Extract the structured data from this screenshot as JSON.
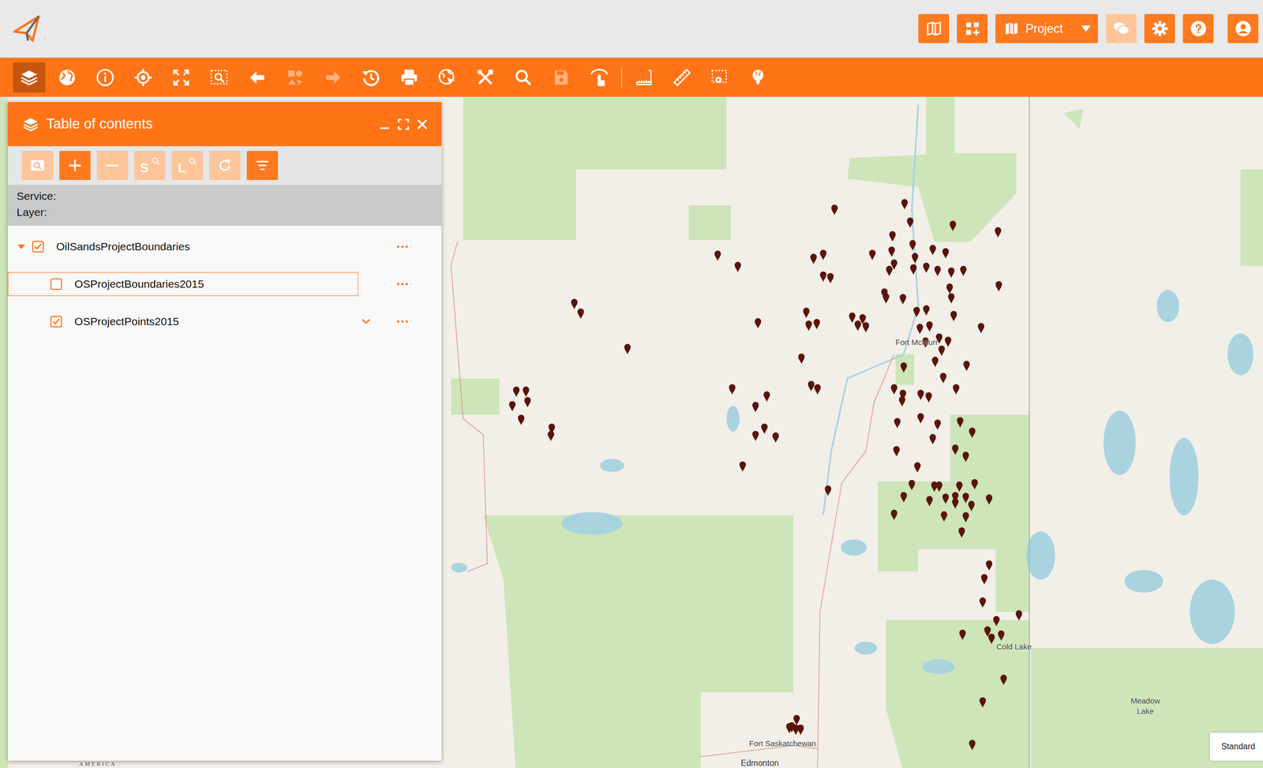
{
  "header": {
    "buttons": [
      {
        "kind": "icon",
        "disabled": false
      },
      {
        "kind": "icon",
        "disabled": false
      },
      {
        "kind": "dropdown",
        "label": "Project",
        "disabled": false
      },
      {
        "kind": "icon",
        "disabled": true
      },
      {
        "kind": "icon",
        "disabled": false
      },
      {
        "kind": "icon",
        "disabled": false
      },
      {
        "kind": "icon",
        "disabled": false
      }
    ]
  },
  "toolbar": {
    "items": [
      {
        "selected": true,
        "disabled": false
      },
      {
        "selected": false,
        "disabled": false
      },
      {
        "selected": false,
        "disabled": false
      },
      {
        "selected": false,
        "disabled": false
      },
      {
        "selected": false,
        "disabled": false
      },
      {
        "selected": false,
        "disabled": false
      },
      {
        "selected": false,
        "disabled": false
      },
      {
        "selected": false,
        "disabled": true
      },
      {
        "selected": false,
        "disabled": true
      },
      {
        "selected": false,
        "disabled": false
      },
      {
        "selected": false,
        "disabled": false
      },
      {
        "selected": false,
        "disabled": false
      },
      {
        "selected": false,
        "disabled": false
      },
      {
        "selected": false,
        "disabled": false
      },
      {
        "selected": false,
        "disabled": true
      },
      {
        "selected": false,
        "disabled": false
      },
      {
        "selected": false,
        "disabled": false
      },
      {
        "selected": false,
        "disabled": false
      },
      {
        "selected": false,
        "disabled": false
      },
      {
        "selected": false,
        "disabled": false
      }
    ]
  },
  "toc": {
    "title": "Table of contents",
    "tools": [
      {
        "disabled": true
      },
      {
        "disabled": false
      },
      {
        "disabled": true
      },
      {
        "glyph": "S",
        "disabled": true
      },
      {
        "glyph": "L",
        "disabled": true
      },
      {
        "disabled": true
      },
      {
        "disabled": false
      }
    ],
    "service_label": "Service:",
    "layer_label": "Layer:",
    "layers": [
      {
        "name": "OilSandsProjectBoundaries",
        "kind": "group",
        "checked": true,
        "expanded": true,
        "selected": false,
        "legend": false
      },
      {
        "name": "OSProjectBoundaries2015",
        "kind": "layer",
        "checked": false,
        "selected": true,
        "legend": false
      },
      {
        "name": "OSProjectPoints2015",
        "kind": "layer",
        "checked": true,
        "selected": false,
        "legend": true
      }
    ]
  },
  "map": {
    "labels": [
      "Fort McMurr",
      "Cold Lake",
      "Meadow Lake",
      "Fort Saskatchewan",
      "Edmonton",
      "AMERICA"
    ],
    "basemap_button": "Standard"
  }
}
